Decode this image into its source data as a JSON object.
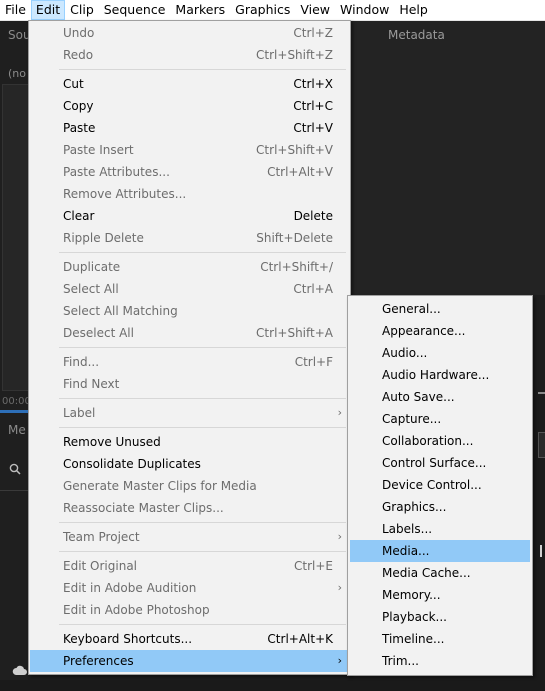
{
  "menubar": {
    "items": [
      "File",
      "Edit",
      "Clip",
      "Sequence",
      "Markers",
      "Graphics",
      "View",
      "Window",
      "Help"
    ],
    "active": "Edit"
  },
  "background": {
    "source_tab": "Sou",
    "metadata_tab": "Metadata",
    "no_clip_text": "(no",
    "timecode": "00:00",
    "media_tab": "Me"
  },
  "edit_menu": {
    "items": [
      {
        "label": "Undo",
        "shortcut": "Ctrl+Z",
        "enabled": false
      },
      {
        "label": "Redo",
        "shortcut": "Ctrl+Shift+Z",
        "enabled": false
      },
      {
        "separator": true
      },
      {
        "label": "Cut",
        "shortcut": "Ctrl+X",
        "enabled": true
      },
      {
        "label": "Copy",
        "shortcut": "Ctrl+C",
        "enabled": true
      },
      {
        "label": "Paste",
        "shortcut": "Ctrl+V",
        "enabled": true
      },
      {
        "label": "Paste Insert",
        "shortcut": "Ctrl+Shift+V",
        "enabled": false
      },
      {
        "label": "Paste Attributes...",
        "shortcut": "Ctrl+Alt+V",
        "enabled": false
      },
      {
        "label": "Remove Attributes...",
        "shortcut": "",
        "enabled": false
      },
      {
        "label": "Clear",
        "shortcut": "Delete",
        "enabled": true
      },
      {
        "label": "Ripple Delete",
        "shortcut": "Shift+Delete",
        "enabled": false
      },
      {
        "separator": true
      },
      {
        "label": "Duplicate",
        "shortcut": "Ctrl+Shift+/",
        "enabled": false
      },
      {
        "label": "Select All",
        "shortcut": "Ctrl+A",
        "enabled": false
      },
      {
        "label": "Select All Matching",
        "shortcut": "",
        "enabled": false
      },
      {
        "label": "Deselect All",
        "shortcut": "Ctrl+Shift+A",
        "enabled": false
      },
      {
        "separator": true
      },
      {
        "label": "Find...",
        "shortcut": "Ctrl+F",
        "enabled": false
      },
      {
        "label": "Find Next",
        "shortcut": "",
        "enabled": false
      },
      {
        "separator": true
      },
      {
        "label": "Label",
        "shortcut": "",
        "enabled": false,
        "submenu": true
      },
      {
        "separator": true
      },
      {
        "label": "Remove Unused",
        "shortcut": "",
        "enabled": true
      },
      {
        "label": "Consolidate Duplicates",
        "shortcut": "",
        "enabled": true
      },
      {
        "label": "Generate Master Clips for Media",
        "shortcut": "",
        "enabled": false
      },
      {
        "label": "Reassociate Master Clips...",
        "shortcut": "",
        "enabled": false
      },
      {
        "separator": true
      },
      {
        "label": "Team Project",
        "shortcut": "",
        "enabled": false,
        "submenu": true
      },
      {
        "separator": true
      },
      {
        "label": "Edit Original",
        "shortcut": "Ctrl+E",
        "enabled": false
      },
      {
        "label": "Edit in Adobe Audition",
        "shortcut": "",
        "enabled": false,
        "submenu": true
      },
      {
        "label": "Edit in Adobe Photoshop",
        "shortcut": "",
        "enabled": false
      },
      {
        "separator": true
      },
      {
        "label": "Keyboard Shortcuts...",
        "shortcut": "Ctrl+Alt+K",
        "enabled": true
      },
      {
        "label": "Preferences",
        "shortcut": "",
        "enabled": true,
        "submenu": true,
        "highlighted": true
      }
    ]
  },
  "preferences_menu": {
    "items": [
      {
        "label": "General..."
      },
      {
        "label": "Appearance..."
      },
      {
        "label": "Audio..."
      },
      {
        "label": "Audio Hardware..."
      },
      {
        "label": "Auto Save..."
      },
      {
        "label": "Capture..."
      },
      {
        "label": "Collaboration..."
      },
      {
        "label": "Control Surface..."
      },
      {
        "label": "Device Control..."
      },
      {
        "label": "Graphics..."
      },
      {
        "label": "Labels..."
      },
      {
        "label": "Media...",
        "highlighted": true
      },
      {
        "label": "Media Cache..."
      },
      {
        "label": "Memory..."
      },
      {
        "label": "Playback..."
      },
      {
        "label": "Timeline..."
      },
      {
        "label": "Trim..."
      }
    ]
  },
  "icons": {
    "submenu_arrow": "chevron-right-icon",
    "search": "search-icon",
    "cloud": "cloud-icon"
  }
}
